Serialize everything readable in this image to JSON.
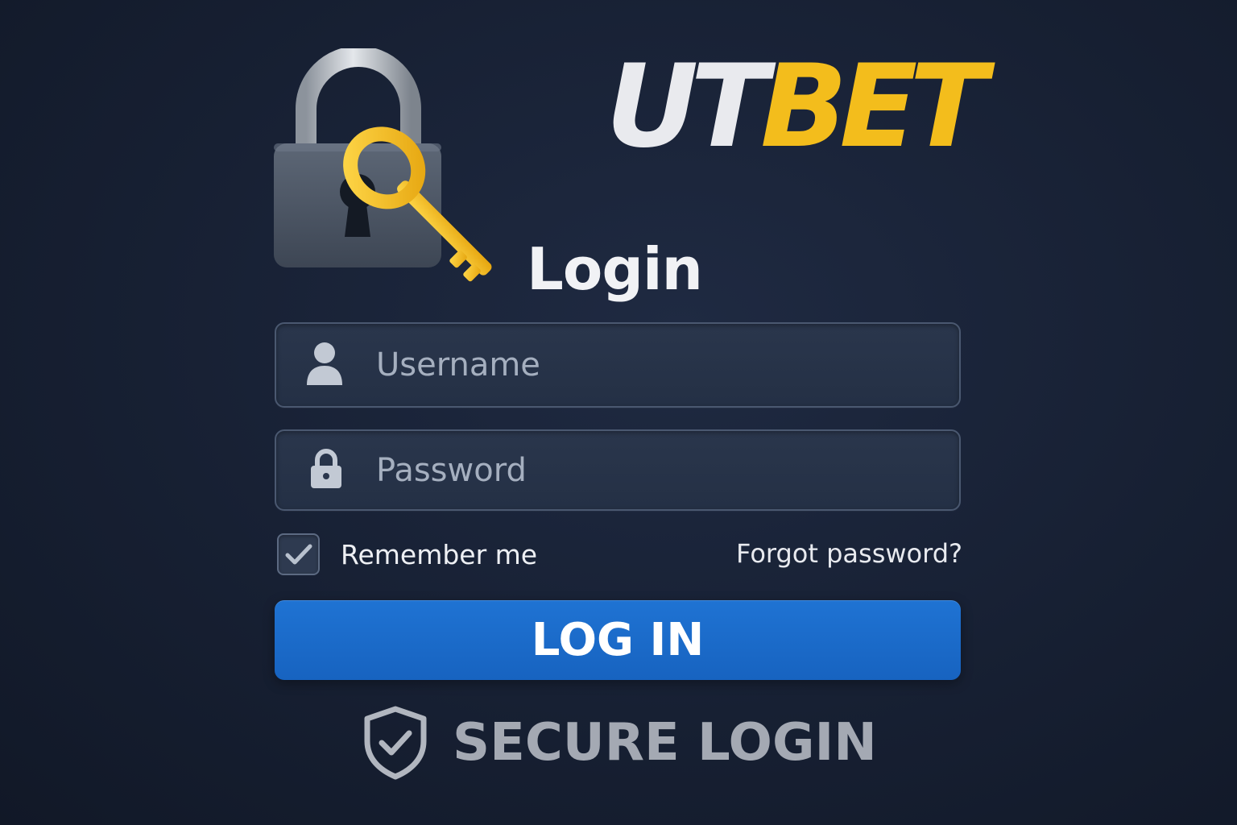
{
  "brand": {
    "part1": "UT",
    "part2": "BET"
  },
  "form": {
    "title": "Login",
    "username": {
      "placeholder": "Username",
      "value": ""
    },
    "password": {
      "placeholder": "Password",
      "value": ""
    },
    "remember_label": "Remember me",
    "remember_checked": true,
    "forgot_link": "Forgot password?",
    "submit_label": "LOG IN"
  },
  "footer": {
    "secure_label": "SECURE LOGIN"
  },
  "icons": {
    "hero": "padlock-with-key-icon",
    "username": "user-icon",
    "password": "lock-icon",
    "secure": "shield-check-icon"
  },
  "colors": {
    "background": "#172033",
    "accent_yellow": "#f3bd1c",
    "button_blue": "#1a6bcb"
  }
}
